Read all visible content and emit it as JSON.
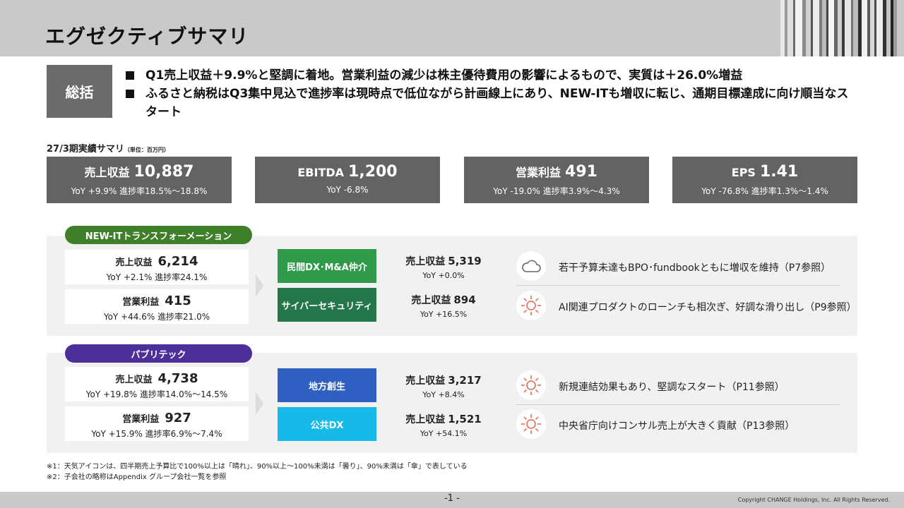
{
  "header": {
    "title": "エグゼクティブサマリ"
  },
  "summary": {
    "label": "総括",
    "bullets": [
      "Q1売上収益＋9.9%と堅調に着地。営業利益の減少は株主優待費用の影響によるもので、実質は＋26.0%増益",
      "ふるさと納税はQ3集中見込で進捗率は現時点で低位ながら計画線上にあり、NEW-ITも増収に転じ、通期目標達成に向け順当なスタート"
    ]
  },
  "kpi_section": {
    "label": "27/3期実績サマリ",
    "unit": "（単位：百万円）",
    "items": [
      {
        "name": "売上収益",
        "value": "10,887",
        "sub": "YoY +9.9%  進捗率18.5%～18.8%"
      },
      {
        "name": "EBITDA",
        "value": "1,200",
        "sub": "YoY -6.8%"
      },
      {
        "name": "営業利益",
        "value": "491",
        "sub": "YoY -19.0%  進捗率3.9%～4.3%"
      },
      {
        "name": "EPS",
        "value": "1.41",
        "sub": "YoY -76.8%  進捗率1.3%～1.4%"
      }
    ]
  },
  "newit": {
    "label": "NEW-ITトランスフォーメーション",
    "color": "#3f7f2a",
    "revenue": {
      "name": "売上収益",
      "value": "6,214",
      "sub": "YoY +2.1%  進捗率24.1%"
    },
    "profit": {
      "name": "営業利益",
      "value": "415",
      "sub": "YoY +44.6%  進捗率21.0%"
    },
    "segments": [
      {
        "label": "民間DX･M&A仲介",
        "color": "#2e9a4a",
        "name": "売上収益",
        "value": "5,319",
        "yoy": "YoY +0.0%",
        "icon": "cloud-icon",
        "comment": "若干予算未達もBPO･fundbookともに増収を維持（P7参照）"
      },
      {
        "label": "サイバーセキュリティ",
        "color": "#24774a",
        "name": "売上収益",
        "value": "894",
        "yoy": "YoY +16.5%",
        "icon": "sun-icon",
        "comment": "AI関連プロダクトのローンチも相次ぎ、好調な滑り出し（P9参照）"
      }
    ]
  },
  "public": {
    "label": "パブリテック",
    "color": "#4d2f9a",
    "revenue": {
      "name": "売上収益",
      "value": "4,738",
      "sub": "YoY +19.8%  進捗率14.0%～14.5%"
    },
    "profit": {
      "name": "営業利益",
      "value": "927",
      "sub": "YoY +15.9%  進捗率6.9%～7.4%"
    },
    "segments": [
      {
        "label": "地方創生",
        "color": "#2f5fc0",
        "name": "売上収益",
        "value": "3,217",
        "yoy": "YoY +8.4%",
        "icon": "sun-icon",
        "comment": "新規連結効果もあり、堅調なスタート（P11参照）"
      },
      {
        "label": "公共DX",
        "color": "#16b9e8",
        "name": "売上収益",
        "value": "1,521",
        "yoy": "YoY +54.1%",
        "icon": "sun-icon",
        "comment": "中央省庁向けコンサル売上が大きく貢献（P13参照）"
      }
    ]
  },
  "notes": [
    "※1：天気アイコンは、四半期売上予算比で100%以上は「晴れ」、90%以上～100%未満は「曇り」、90%未満は「傘」で表している",
    "※2：子会社の略称はAppendix グループ会社一覧を参照"
  ],
  "footer": {
    "page": "-1 -",
    "copyright": "Copyright CHANGE Holdings, Inc. All Rights Reserved."
  }
}
